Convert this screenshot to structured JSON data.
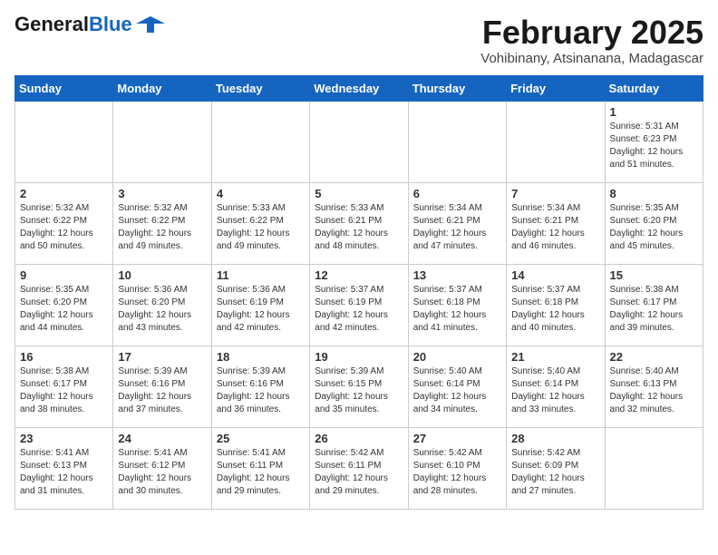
{
  "header": {
    "logo_line1": "General",
    "logo_line2": "Blue",
    "month_title": "February 2025",
    "location": "Vohibinany, Atsinanana, Madagascar"
  },
  "days_of_week": [
    "Sunday",
    "Monday",
    "Tuesday",
    "Wednesday",
    "Thursday",
    "Friday",
    "Saturday"
  ],
  "weeks": [
    [
      {
        "day": "",
        "info": ""
      },
      {
        "day": "",
        "info": ""
      },
      {
        "day": "",
        "info": ""
      },
      {
        "day": "",
        "info": ""
      },
      {
        "day": "",
        "info": ""
      },
      {
        "day": "",
        "info": ""
      },
      {
        "day": "1",
        "info": "Sunrise: 5:31 AM\nSunset: 6:23 PM\nDaylight: 12 hours\nand 51 minutes."
      }
    ],
    [
      {
        "day": "2",
        "info": "Sunrise: 5:32 AM\nSunset: 6:22 PM\nDaylight: 12 hours\nand 50 minutes."
      },
      {
        "day": "3",
        "info": "Sunrise: 5:32 AM\nSunset: 6:22 PM\nDaylight: 12 hours\nand 49 minutes."
      },
      {
        "day": "4",
        "info": "Sunrise: 5:33 AM\nSunset: 6:22 PM\nDaylight: 12 hours\nand 49 minutes."
      },
      {
        "day": "5",
        "info": "Sunrise: 5:33 AM\nSunset: 6:21 PM\nDaylight: 12 hours\nand 48 minutes."
      },
      {
        "day": "6",
        "info": "Sunrise: 5:34 AM\nSunset: 6:21 PM\nDaylight: 12 hours\nand 47 minutes."
      },
      {
        "day": "7",
        "info": "Sunrise: 5:34 AM\nSunset: 6:21 PM\nDaylight: 12 hours\nand 46 minutes."
      },
      {
        "day": "8",
        "info": "Sunrise: 5:35 AM\nSunset: 6:20 PM\nDaylight: 12 hours\nand 45 minutes."
      }
    ],
    [
      {
        "day": "9",
        "info": "Sunrise: 5:35 AM\nSunset: 6:20 PM\nDaylight: 12 hours\nand 44 minutes."
      },
      {
        "day": "10",
        "info": "Sunrise: 5:36 AM\nSunset: 6:20 PM\nDaylight: 12 hours\nand 43 minutes."
      },
      {
        "day": "11",
        "info": "Sunrise: 5:36 AM\nSunset: 6:19 PM\nDaylight: 12 hours\nand 42 minutes."
      },
      {
        "day": "12",
        "info": "Sunrise: 5:37 AM\nSunset: 6:19 PM\nDaylight: 12 hours\nand 42 minutes."
      },
      {
        "day": "13",
        "info": "Sunrise: 5:37 AM\nSunset: 6:18 PM\nDaylight: 12 hours\nand 41 minutes."
      },
      {
        "day": "14",
        "info": "Sunrise: 5:37 AM\nSunset: 6:18 PM\nDaylight: 12 hours\nand 40 minutes."
      },
      {
        "day": "15",
        "info": "Sunrise: 5:38 AM\nSunset: 6:17 PM\nDaylight: 12 hours\nand 39 minutes."
      }
    ],
    [
      {
        "day": "16",
        "info": "Sunrise: 5:38 AM\nSunset: 6:17 PM\nDaylight: 12 hours\nand 38 minutes."
      },
      {
        "day": "17",
        "info": "Sunrise: 5:39 AM\nSunset: 6:16 PM\nDaylight: 12 hours\nand 37 minutes."
      },
      {
        "day": "18",
        "info": "Sunrise: 5:39 AM\nSunset: 6:16 PM\nDaylight: 12 hours\nand 36 minutes."
      },
      {
        "day": "19",
        "info": "Sunrise: 5:39 AM\nSunset: 6:15 PM\nDaylight: 12 hours\nand 35 minutes."
      },
      {
        "day": "20",
        "info": "Sunrise: 5:40 AM\nSunset: 6:14 PM\nDaylight: 12 hours\nand 34 minutes."
      },
      {
        "day": "21",
        "info": "Sunrise: 5:40 AM\nSunset: 6:14 PM\nDaylight: 12 hours\nand 33 minutes."
      },
      {
        "day": "22",
        "info": "Sunrise: 5:40 AM\nSunset: 6:13 PM\nDaylight: 12 hours\nand 32 minutes."
      }
    ],
    [
      {
        "day": "23",
        "info": "Sunrise: 5:41 AM\nSunset: 6:13 PM\nDaylight: 12 hours\nand 31 minutes."
      },
      {
        "day": "24",
        "info": "Sunrise: 5:41 AM\nSunset: 6:12 PM\nDaylight: 12 hours\nand 30 minutes."
      },
      {
        "day": "25",
        "info": "Sunrise: 5:41 AM\nSunset: 6:11 PM\nDaylight: 12 hours\nand 29 minutes."
      },
      {
        "day": "26",
        "info": "Sunrise: 5:42 AM\nSunset: 6:11 PM\nDaylight: 12 hours\nand 29 minutes."
      },
      {
        "day": "27",
        "info": "Sunrise: 5:42 AM\nSunset: 6:10 PM\nDaylight: 12 hours\nand 28 minutes."
      },
      {
        "day": "28",
        "info": "Sunrise: 5:42 AM\nSunset: 6:09 PM\nDaylight: 12 hours\nand 27 minutes."
      },
      {
        "day": "",
        "info": ""
      }
    ]
  ]
}
